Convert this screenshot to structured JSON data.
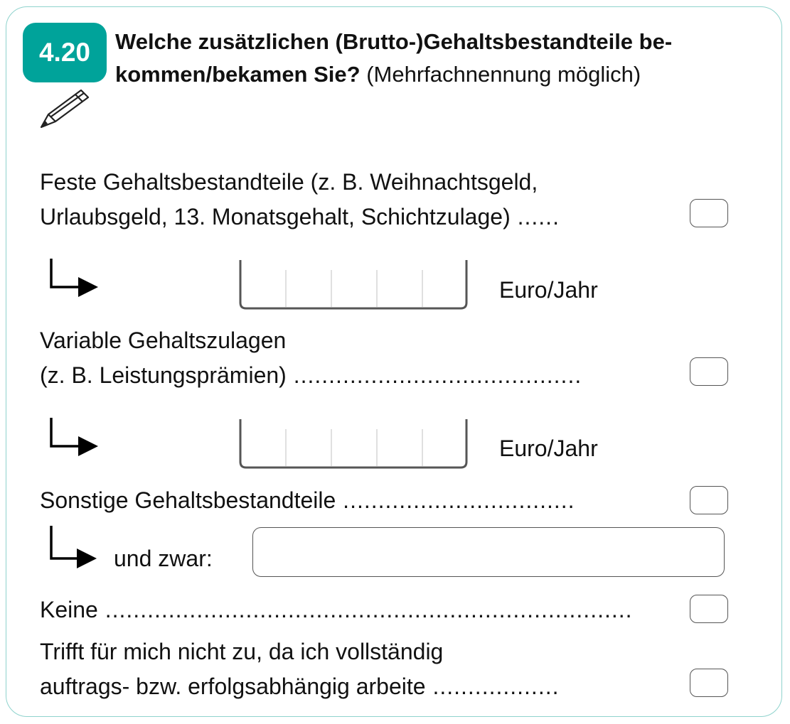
{
  "question": {
    "number": "4.20",
    "title_bold_1": "Welche zusätzlichen (Brutto-)Gehaltsbestandteile be-",
    "title_bold_2": "kommen/bekamen Sie?",
    "title_normal": " (Mehrfachnennung möglich)",
    "icon": "pencil-icon"
  },
  "options": [
    {
      "line1": "Feste Gehaltsbestandteile (z. B. Weihnachtsgeld,",
      "line2": "Urlaubsgeld, 13. Monatsgehalt, Schichtzulage)",
      "dots": " ......",
      "unit": "Euro/Jahr"
    },
    {
      "line1": "Variable Gehaltszulagen",
      "line2": "(z. B. Leistungsprämien)",
      "dots": " .........................................",
      "unit": "Euro/Jahr"
    },
    {
      "line1": "Sonstige Gehaltsbestandteile",
      "dots": " .................................",
      "followup_label": "und zwar:"
    },
    {
      "line1": "Keine",
      "dots": " ..........................................................................."
    },
    {
      "line1": "Trifft für mich nicht zu, da ich vollständig",
      "line2": "auftrags- bzw. erfolgsabhängig arbeite",
      "dots": "  .................."
    }
  ],
  "colors": {
    "accent": "#00a39a",
    "border": "#8fd3cd",
    "box": "#555555"
  }
}
